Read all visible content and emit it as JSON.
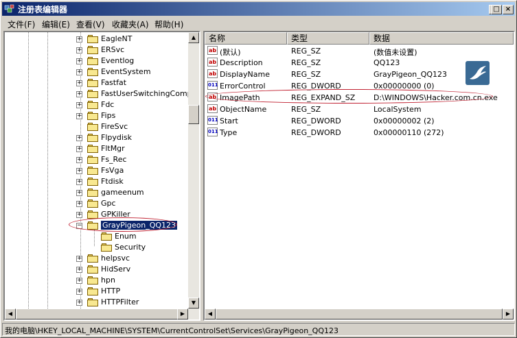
{
  "window": {
    "title": "注册表编辑器",
    "buttons": {
      "minimize": "_",
      "restore": "□",
      "close": "×"
    }
  },
  "menu": [
    "文件(F)",
    "编辑(E)",
    "查看(V)",
    "收藏夹(A)",
    "帮助(H)"
  ],
  "tree": {
    "items": [
      {
        "label": "EagleNT",
        "expandable": true
      },
      {
        "label": "ERSvc",
        "expandable": true
      },
      {
        "label": "Eventlog",
        "expandable": true
      },
      {
        "label": "EventSystem",
        "expandable": true
      },
      {
        "label": "Fastfat",
        "expandable": true
      },
      {
        "label": "FastUserSwitchingCompatib",
        "expandable": true
      },
      {
        "label": "Fdc",
        "expandable": true
      },
      {
        "label": "Fips",
        "expandable": true
      },
      {
        "label": "FireSvc",
        "expandable": false
      },
      {
        "label": "Flpydisk",
        "expandable": true
      },
      {
        "label": "FltMgr",
        "expandable": true
      },
      {
        "label": "Fs_Rec",
        "expandable": true
      },
      {
        "label": "FsVga",
        "expandable": true
      },
      {
        "label": "Ftdisk",
        "expandable": true
      },
      {
        "label": "gameenum",
        "expandable": true
      },
      {
        "label": "Gpc",
        "expandable": true
      },
      {
        "label": "GPKiller",
        "expandable": true
      },
      {
        "label": "GrayPigeon_QQ123",
        "expandable": true,
        "expanded": true,
        "selected": true
      },
      {
        "label": "Enum",
        "child": true
      },
      {
        "label": "Security",
        "child": true
      },
      {
        "label": "helpsvc",
        "expandable": true
      },
      {
        "label": "HidServ",
        "expandable": true
      },
      {
        "label": "hpn",
        "expandable": true
      },
      {
        "label": "HTTP",
        "expandable": true
      },
      {
        "label": "HTTPFilter",
        "expandable": true
      }
    ]
  },
  "list": {
    "columns": {
      "name": "名称",
      "type": "类型",
      "data": "数据"
    },
    "rows": [
      {
        "icon": "ab",
        "name": "(默认)",
        "type": "REG_SZ",
        "data": "(数值未设置)"
      },
      {
        "icon": "ab",
        "name": "Description",
        "type": "REG_SZ",
        "data": "QQ123"
      },
      {
        "icon": "ab",
        "name": "DisplayName",
        "type": "REG_SZ",
        "data": "GrayPigeon_QQ123"
      },
      {
        "icon": "bin",
        "name": "ErrorControl",
        "type": "REG_DWORD",
        "data": "0x00000000 (0)"
      },
      {
        "icon": "ab",
        "name": "ImagePath",
        "type": "REG_EXPAND_SZ",
        "data": "D:\\WINDOWS\\Hacker.com.cn.exe"
      },
      {
        "icon": "ab",
        "name": "ObjectName",
        "type": "REG_SZ",
        "data": "LocalSystem"
      },
      {
        "icon": "bin",
        "name": "Start",
        "type": "REG_DWORD",
        "data": "0x00000002 (2)"
      },
      {
        "icon": "bin",
        "name": "Type",
        "type": "REG_DWORD",
        "data": "0x00000110 (272)"
      }
    ]
  },
  "statusbar": {
    "path": "我的电脑\\HKEY_LOCAL_MACHINE\\SYSTEM\\CurrentControlSet\\Services\\GrayPigeon_QQ123"
  },
  "colors": {
    "titlebar": "#0a246a",
    "selection": "#0a246a",
    "highlight": "#c02030"
  }
}
